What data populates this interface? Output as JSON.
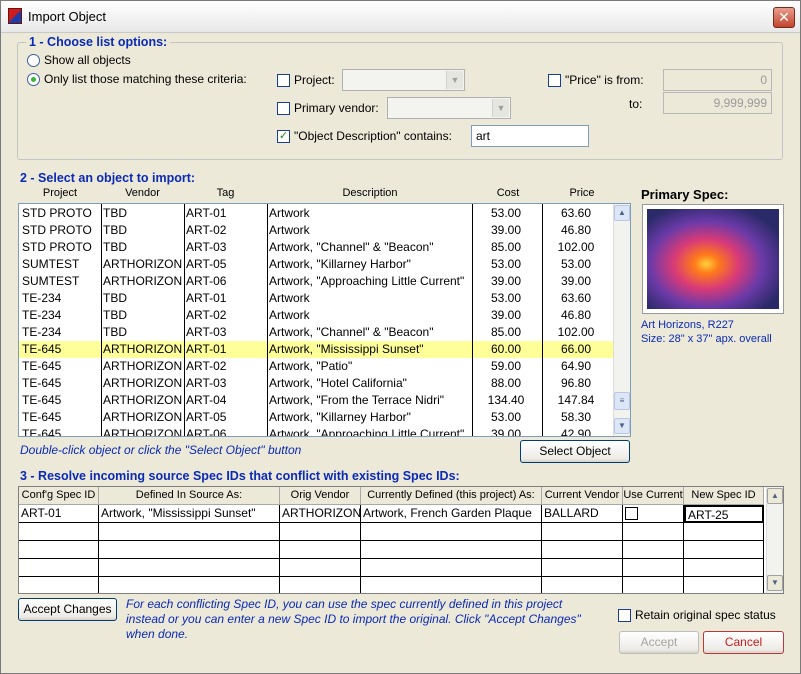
{
  "window": {
    "title": "Import Object",
    "close_glyph": "✕"
  },
  "section1": {
    "title": "1 - Choose list options:",
    "radio_all": "Show all objects",
    "radio_criteria": "Only list those matching these criteria:",
    "project_label": "Project:",
    "vendor_label": "Primary vendor:",
    "desc_label": "\"Object Description\" contains:",
    "desc_value": "art",
    "price_label": "\"Price\" is from:",
    "price_from": "0",
    "to_label": "to:",
    "price_to": "9,999,999",
    "project_checked": false,
    "vendor_checked": false,
    "desc_checked": true,
    "price_checked": false
  },
  "section2": {
    "title": "2 - Select an object to import:",
    "columns": [
      "Project",
      "Vendor",
      "Tag",
      "Description",
      "Cost",
      "Price"
    ],
    "rows": [
      [
        "STD PROTO",
        "TBD",
        "ART-01",
        "Artwork",
        "53.00",
        "63.60"
      ],
      [
        "STD PROTO",
        "TBD",
        "ART-02",
        "Artwork",
        "39.00",
        "46.80"
      ],
      [
        "STD PROTO",
        "TBD",
        "ART-03",
        "Artwork, \"Channel\" & \"Beacon\"",
        "85.00",
        "102.00"
      ],
      [
        "SUMTEST",
        "ARTHORIZON",
        "ART-05",
        "Artwork, \"Killarney Harbor\"",
        "53.00",
        "53.00"
      ],
      [
        "SUMTEST",
        "ARTHORIZON",
        "ART-06",
        "Artwork, \"Approaching Little Current\"",
        "39.00",
        "39.00"
      ],
      [
        "TE-234",
        "TBD",
        "ART-01",
        "Artwork",
        "53.00",
        "63.60"
      ],
      [
        "TE-234",
        "TBD",
        "ART-02",
        "Artwork",
        "39.00",
        "46.80"
      ],
      [
        "TE-234",
        "TBD",
        "ART-03",
        "Artwork, \"Channel\" & \"Beacon\"",
        "85.00",
        "102.00"
      ],
      [
        "TE-645",
        "ARTHORIZON",
        "ART-01",
        "Artwork, \"Mississippi Sunset\"",
        "60.00",
        "66.00"
      ],
      [
        "TE-645",
        "ARTHORIZON",
        "ART-02",
        "Artwork, \"Patio\"",
        "59.00",
        "64.90"
      ],
      [
        "TE-645",
        "ARTHORIZON",
        "ART-03",
        "Artwork, \"Hotel California\"",
        "88.00",
        "96.80"
      ],
      [
        "TE-645",
        "ARTHORIZON",
        "ART-04",
        "Artwork,  \"From the Terrace Nidri\"",
        "134.40",
        "147.84"
      ],
      [
        "TE-645",
        "ARTHORIZON",
        "ART-05",
        "Artwork, \"Killarney Harbor\"",
        "53.00",
        "58.30"
      ],
      [
        "TE-645",
        "ARTHORIZON",
        "ART-06",
        "Artwork, \"Approaching Little Current\"",
        "39.00",
        "42.90"
      ]
    ],
    "hint": "Double-click object or click the \"Select Object\" button",
    "select_button": "Select Object"
  },
  "primary_spec": {
    "title": "Primary Spec:",
    "caption1": "Art Horizons, R227",
    "caption2": "Size: 28\" x 37\" apx. overall"
  },
  "section3": {
    "title": "3 - Resolve incoming source Spec IDs that conflict with existing Spec IDs:",
    "columns": [
      "Conf'g Spec ID",
      "Defined In Source As:",
      "Orig Vendor",
      "Currently Defined (this project) As:",
      "Current Vendor",
      "Use Current",
      "New Spec ID"
    ],
    "rows": [
      [
        "ART-01",
        "Artwork, \"Mississippi Sunset\"",
        "ARTHORIZON",
        "Artwork, French Garden Plaque",
        "BALLARD",
        "",
        "ART-25"
      ]
    ]
  },
  "footer": {
    "accept_changes": "Accept Changes",
    "note": "For each conflicting Spec ID, you can use the spec currently defined in this project instead or you can enter a new Spec ID to import the original.  Click \"Accept Changes\" when done.",
    "retain_label": "Retain original spec status",
    "accept": "Accept",
    "cancel": "Cancel"
  }
}
